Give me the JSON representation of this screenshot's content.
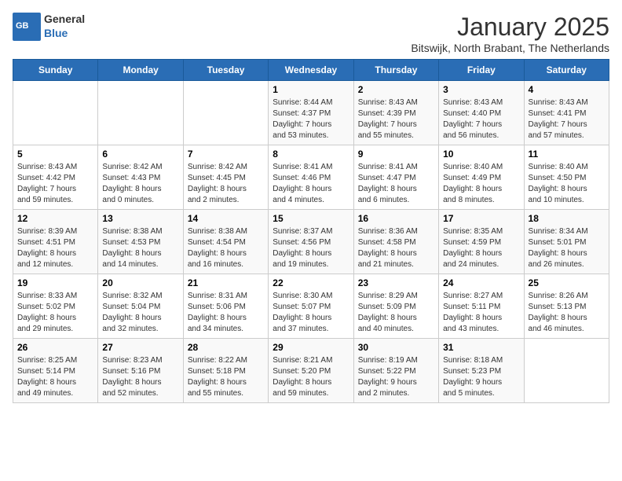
{
  "logo": {
    "text1": "General",
    "text2": "Blue"
  },
  "title": "January 2025",
  "subtitle": "Bitswijk, North Brabant, The Netherlands",
  "days_of_week": [
    "Sunday",
    "Monday",
    "Tuesday",
    "Wednesday",
    "Thursday",
    "Friday",
    "Saturday"
  ],
  "weeks": [
    [
      {
        "day": "",
        "info": ""
      },
      {
        "day": "",
        "info": ""
      },
      {
        "day": "",
        "info": ""
      },
      {
        "day": "1",
        "info": "Sunrise: 8:44 AM\nSunset: 4:37 PM\nDaylight: 7 hours\nand 53 minutes."
      },
      {
        "day": "2",
        "info": "Sunrise: 8:43 AM\nSunset: 4:39 PM\nDaylight: 7 hours\nand 55 minutes."
      },
      {
        "day": "3",
        "info": "Sunrise: 8:43 AM\nSunset: 4:40 PM\nDaylight: 7 hours\nand 56 minutes."
      },
      {
        "day": "4",
        "info": "Sunrise: 8:43 AM\nSunset: 4:41 PM\nDaylight: 7 hours\nand 57 minutes."
      }
    ],
    [
      {
        "day": "5",
        "info": "Sunrise: 8:43 AM\nSunset: 4:42 PM\nDaylight: 7 hours\nand 59 minutes."
      },
      {
        "day": "6",
        "info": "Sunrise: 8:42 AM\nSunset: 4:43 PM\nDaylight: 8 hours\nand 0 minutes."
      },
      {
        "day": "7",
        "info": "Sunrise: 8:42 AM\nSunset: 4:45 PM\nDaylight: 8 hours\nand 2 minutes."
      },
      {
        "day": "8",
        "info": "Sunrise: 8:41 AM\nSunset: 4:46 PM\nDaylight: 8 hours\nand 4 minutes."
      },
      {
        "day": "9",
        "info": "Sunrise: 8:41 AM\nSunset: 4:47 PM\nDaylight: 8 hours\nand 6 minutes."
      },
      {
        "day": "10",
        "info": "Sunrise: 8:40 AM\nSunset: 4:49 PM\nDaylight: 8 hours\nand 8 minutes."
      },
      {
        "day": "11",
        "info": "Sunrise: 8:40 AM\nSunset: 4:50 PM\nDaylight: 8 hours\nand 10 minutes."
      }
    ],
    [
      {
        "day": "12",
        "info": "Sunrise: 8:39 AM\nSunset: 4:51 PM\nDaylight: 8 hours\nand 12 minutes."
      },
      {
        "day": "13",
        "info": "Sunrise: 8:38 AM\nSunset: 4:53 PM\nDaylight: 8 hours\nand 14 minutes."
      },
      {
        "day": "14",
        "info": "Sunrise: 8:38 AM\nSunset: 4:54 PM\nDaylight: 8 hours\nand 16 minutes."
      },
      {
        "day": "15",
        "info": "Sunrise: 8:37 AM\nSunset: 4:56 PM\nDaylight: 8 hours\nand 19 minutes."
      },
      {
        "day": "16",
        "info": "Sunrise: 8:36 AM\nSunset: 4:58 PM\nDaylight: 8 hours\nand 21 minutes."
      },
      {
        "day": "17",
        "info": "Sunrise: 8:35 AM\nSunset: 4:59 PM\nDaylight: 8 hours\nand 24 minutes."
      },
      {
        "day": "18",
        "info": "Sunrise: 8:34 AM\nSunset: 5:01 PM\nDaylight: 8 hours\nand 26 minutes."
      }
    ],
    [
      {
        "day": "19",
        "info": "Sunrise: 8:33 AM\nSunset: 5:02 PM\nDaylight: 8 hours\nand 29 minutes."
      },
      {
        "day": "20",
        "info": "Sunrise: 8:32 AM\nSunset: 5:04 PM\nDaylight: 8 hours\nand 32 minutes."
      },
      {
        "day": "21",
        "info": "Sunrise: 8:31 AM\nSunset: 5:06 PM\nDaylight: 8 hours\nand 34 minutes."
      },
      {
        "day": "22",
        "info": "Sunrise: 8:30 AM\nSunset: 5:07 PM\nDaylight: 8 hours\nand 37 minutes."
      },
      {
        "day": "23",
        "info": "Sunrise: 8:29 AM\nSunset: 5:09 PM\nDaylight: 8 hours\nand 40 minutes."
      },
      {
        "day": "24",
        "info": "Sunrise: 8:27 AM\nSunset: 5:11 PM\nDaylight: 8 hours\nand 43 minutes."
      },
      {
        "day": "25",
        "info": "Sunrise: 8:26 AM\nSunset: 5:13 PM\nDaylight: 8 hours\nand 46 minutes."
      }
    ],
    [
      {
        "day": "26",
        "info": "Sunrise: 8:25 AM\nSunset: 5:14 PM\nDaylight: 8 hours\nand 49 minutes."
      },
      {
        "day": "27",
        "info": "Sunrise: 8:23 AM\nSunset: 5:16 PM\nDaylight: 8 hours\nand 52 minutes."
      },
      {
        "day": "28",
        "info": "Sunrise: 8:22 AM\nSunset: 5:18 PM\nDaylight: 8 hours\nand 55 minutes."
      },
      {
        "day": "29",
        "info": "Sunrise: 8:21 AM\nSunset: 5:20 PM\nDaylight: 8 hours\nand 59 minutes."
      },
      {
        "day": "30",
        "info": "Sunrise: 8:19 AM\nSunset: 5:22 PM\nDaylight: 9 hours\nand 2 minutes."
      },
      {
        "day": "31",
        "info": "Sunrise: 8:18 AM\nSunset: 5:23 PM\nDaylight: 9 hours\nand 5 minutes."
      },
      {
        "day": "",
        "info": ""
      }
    ]
  ]
}
